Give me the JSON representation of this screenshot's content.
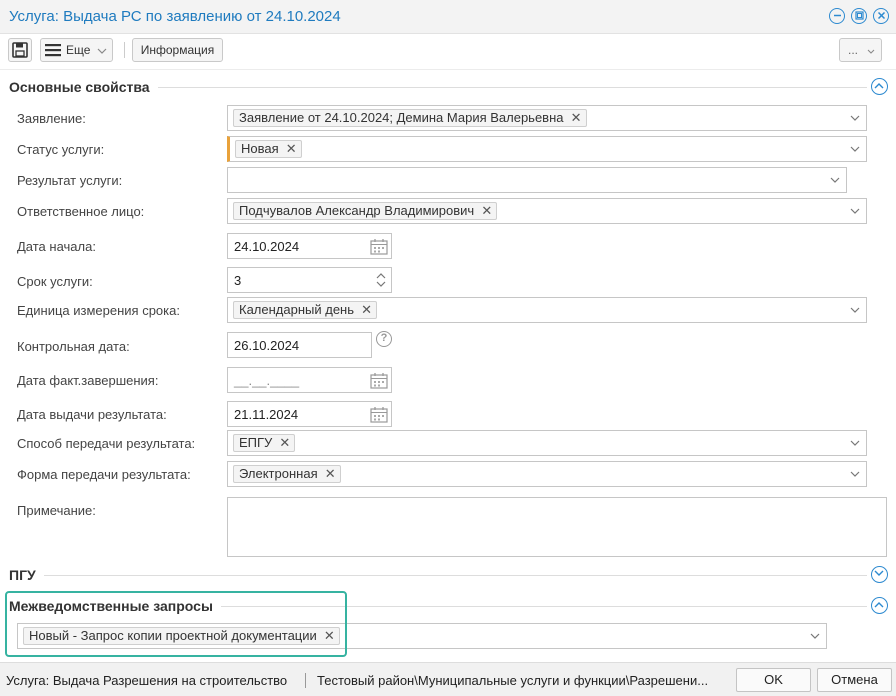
{
  "window": {
    "title": "Услуга: Выдача РС по заявлению от 24.10.2024",
    "icons": {
      "minimize": "minus-circle-icon",
      "restore": "restore-circle-icon",
      "close": "close-circle-icon"
    }
  },
  "toolbar": {
    "save_icon": "floppy-disk-icon",
    "more_label": "Еще",
    "info_label": "Информация",
    "ellipsis_label": "..."
  },
  "sections": {
    "main": {
      "title": "Основные свойства",
      "fields": {
        "statement": {
          "label": "Заявление:",
          "value": "Заявление от 24.10.2024; Демина Мария Валерьевна"
        },
        "status": {
          "label": "Статус услуги:",
          "value": "Новая",
          "accent_color": "#e9a23b"
        },
        "result": {
          "label": "Результат услуги:",
          "value": ""
        },
        "responsible": {
          "label": "Ответственное лицо:",
          "value": "Подчувалов Александр Владимирович"
        },
        "start_date": {
          "label": "Дата начала:",
          "value": "24.10.2024"
        },
        "term": {
          "label": "Срок услуги:",
          "value": "3"
        },
        "term_unit": {
          "label": "Единица измерения срока:",
          "value": "Календарный день"
        },
        "control_date": {
          "label": "Контрольная дата:",
          "value": "26.10.2024"
        },
        "actual_end": {
          "label": "Дата факт.завершения:",
          "placeholder": "__.__.____"
        },
        "issue_date": {
          "label": "Дата выдачи результата:",
          "value": "21.11.2024"
        },
        "transfer_method": {
          "label": "Способ передачи результата:",
          "value": "ЕПГУ"
        },
        "transfer_form": {
          "label": "Форма передачи результата:",
          "value": "Электронная"
        },
        "note": {
          "label": "Примечание:",
          "value": ""
        }
      }
    },
    "pgu": {
      "title": "ПГУ"
    },
    "interagency": {
      "title": "Межведомственные запросы",
      "value": "Новый - Запрос копии проектной документации"
    }
  },
  "statusbar": {
    "service": "Услуга: Выдача Разрешения на строительство",
    "path": "Тестовый район\\Муниципальные услуги и функции\\Разрешени...",
    "ok_label": "OK",
    "cancel_label": "Отмена"
  },
  "colors": {
    "accent": "#1f7bbf",
    "highlight": "#36b3a1",
    "status_marker": "#e9a23b"
  }
}
